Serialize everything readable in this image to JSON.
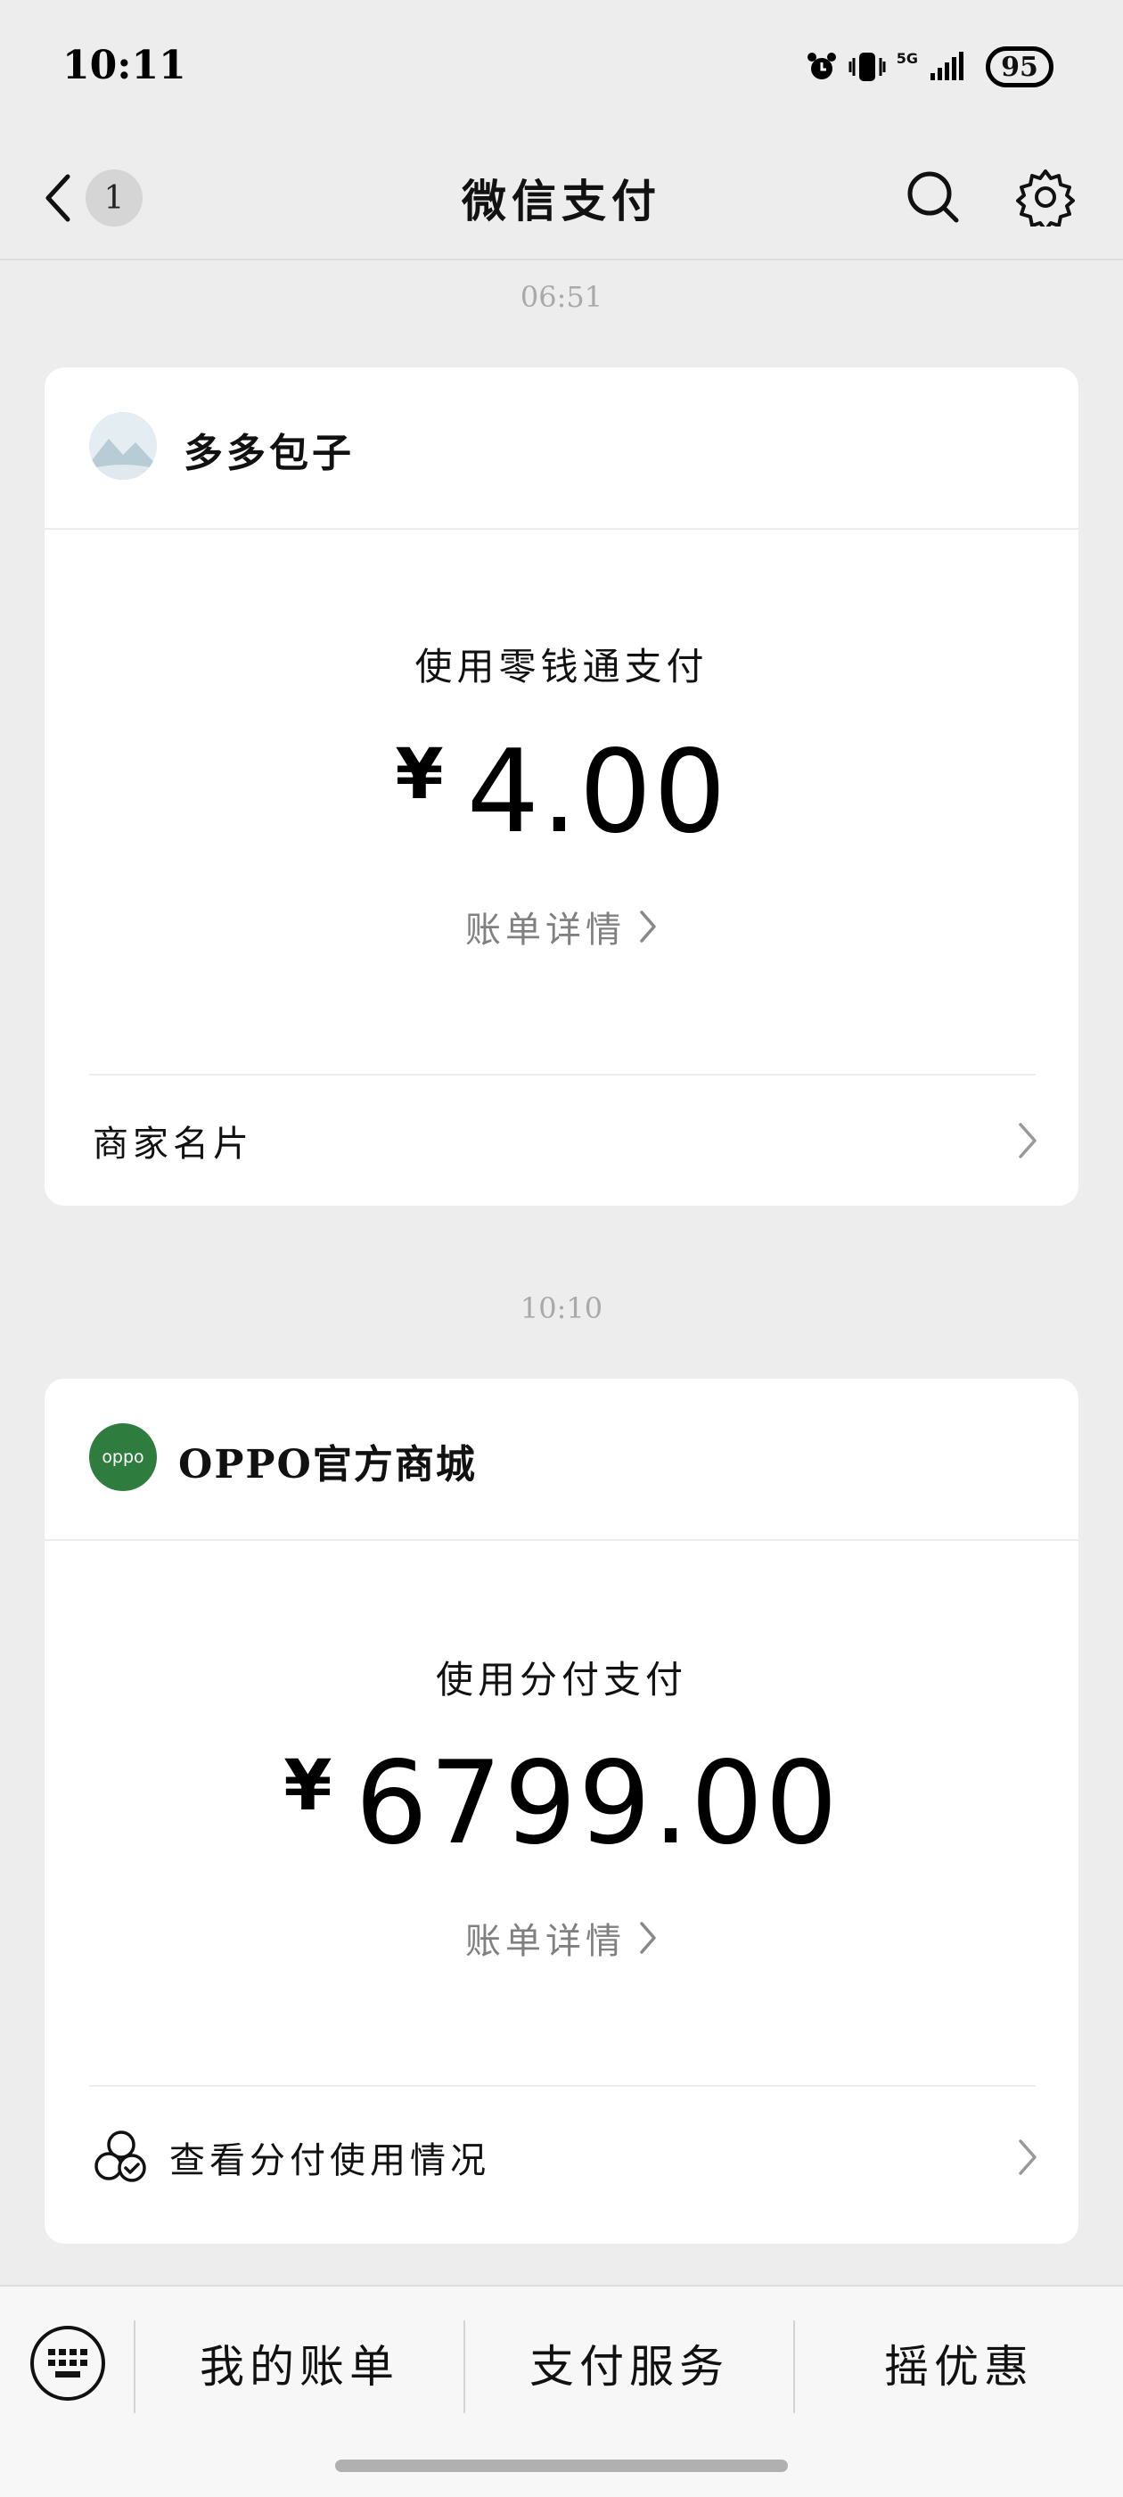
{
  "status_bar": {
    "time": "10:11",
    "network": "5G",
    "battery": "95"
  },
  "nav": {
    "title": "微信支付",
    "unread_count": "1"
  },
  "messages": [
    {
      "timestamp": "06:51",
      "merchant": "多多包子",
      "pay_method": "使用零钱通支付",
      "currency": "¥",
      "amount": "4.00",
      "bill_link": "账单详情",
      "footer": "商家名片"
    },
    {
      "timestamp": "10:10",
      "merchant": "OPPO官方商城",
      "merchant_logo_text": "oppo",
      "pay_method": "使用分付支付",
      "currency": "¥",
      "amount": "6799.00",
      "bill_link": "账单详情",
      "footer": "查看分付使用情况"
    }
  ],
  "bottom_menu": {
    "items": [
      "我的账单",
      "支付服务",
      "摇优惠"
    ]
  },
  "colors": {
    "oppo_green": "#2e7d3e",
    "background": "#ededed"
  }
}
